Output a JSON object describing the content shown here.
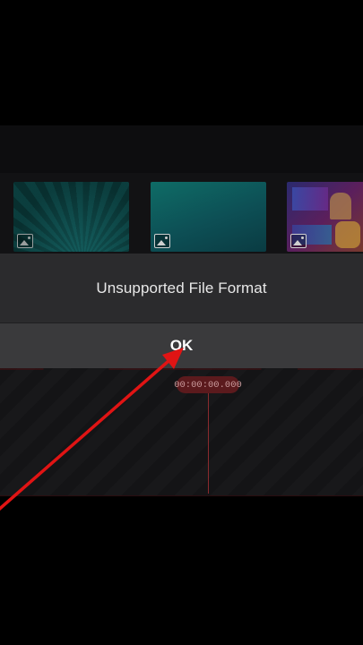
{
  "dialog": {
    "message": "Unsupported File Format",
    "ok_label": "OK"
  },
  "timeline": {
    "timecode": "00:00:00.000"
  },
  "media": {
    "items": [
      {
        "type": "image",
        "icon": "image-icon"
      },
      {
        "type": "image",
        "icon": "image-icon"
      },
      {
        "type": "image",
        "icon": "image-icon"
      }
    ]
  },
  "colors": {
    "dialog_bg": "#2b2b2d",
    "accent_red": "#e01414",
    "timecode_pill": "#5b1a1d"
  }
}
